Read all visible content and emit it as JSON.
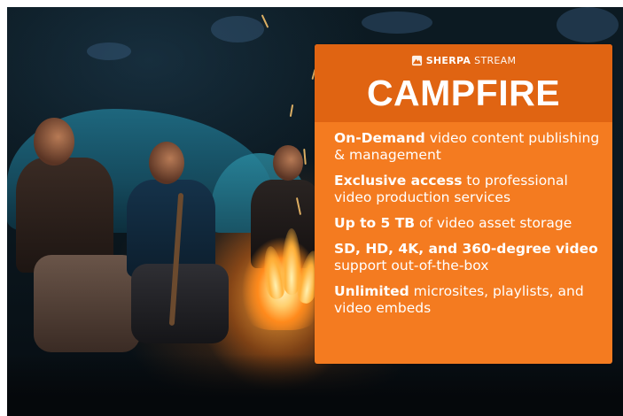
{
  "brand": {
    "icon": "mountain-box-logo-icon",
    "name_bold": "SHERPA",
    "name_light": "STREAM"
  },
  "card": {
    "title": "CAMPFIRE",
    "features": [
      {
        "bold": "On-Demand",
        "rest": " video content publishing & management"
      },
      {
        "bold": "Exclusive access",
        "rest": " to professional video production services"
      },
      {
        "bold": "Up to 5 TB",
        "rest": " of video asset storage"
      },
      {
        "bold": "SD, HD, 4K, and 360-degree video",
        "rest": " support out-of-the-box"
      },
      {
        "bold": "Unlimited",
        "rest": " microsites, playlists, and video embeds"
      }
    ]
  },
  "colors": {
    "card_bg": "#f47b20",
    "card_header": "#e06412",
    "text": "#ffffff"
  }
}
